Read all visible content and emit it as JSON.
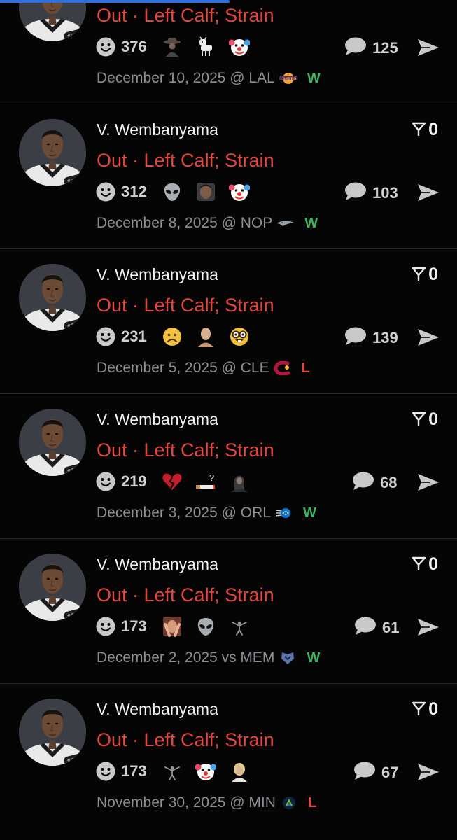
{
  "posts": [
    {
      "name": "",
      "status": "Out · Left Calf; Strain",
      "flag_count": "",
      "react_count": "376",
      "emojis": [
        "cowboy-emoji",
        "goat-emoji",
        "clown-emoji"
      ],
      "comment_count": "125",
      "date": "December 10, 2025 @ LAL",
      "team_logo": "lakers-logo",
      "result": "W",
      "result_color": "#3fb55d"
    },
    {
      "name": "V. Wembanyama",
      "status": "Out · Left Calf; Strain",
      "flag_count": "0",
      "react_count": "312",
      "emojis": [
        "alien-emoji",
        "face-photo-emoji",
        "clown-emoji"
      ],
      "comment_count": "103",
      "date": "December 8, 2025 @ NOP",
      "team_logo": "pelicans-logo",
      "result": "W",
      "result_color": "#3fb55d"
    },
    {
      "name": "V. Wembanyama",
      "status": "Out · Left Calf; Strain",
      "flag_count": "0",
      "react_count": "231",
      "emojis": [
        "frowning-face-emoji",
        "bald-head-emoji",
        "nerd-face-emoji"
      ],
      "comment_count": "139",
      "date": "December 5, 2025 @ CLE",
      "team_logo": "cavaliers-logo",
      "result": "L",
      "result_color": "#e2463c"
    },
    {
      "name": "V. Wembanyama",
      "status": "Out · Left Calf; Strain",
      "flag_count": "0",
      "react_count": "219",
      "emojis": [
        "broken-heart-emoji",
        "cigarette-question-emoji",
        "hooded-figure-emoji"
      ],
      "comment_count": "68",
      "date": "December 3, 2025 @ ORL",
      "team_logo": "magic-logo",
      "result": "W",
      "result_color": "#3fb55d"
    },
    {
      "name": "V. Wembanyama",
      "status": "Out · Left Calf; Strain",
      "flag_count": "0",
      "react_count": "173",
      "emojis": [
        "face-palm-photo-emoji",
        "alien-emoji",
        "dunk-silhouette-emoji"
      ],
      "comment_count": "61",
      "date": "December 2, 2025 vs MEM",
      "team_logo": "grizzlies-logo",
      "result": "W",
      "result_color": "#3fb55d"
    },
    {
      "name": "V. Wembanyama",
      "status": "Out · Left Calf; Strain",
      "flag_count": "0",
      "react_count": "173",
      "emojis": [
        "dunk-silhouette-emoji",
        "clown-emoji",
        "blonde-head-emoji"
      ],
      "comment_count": "67",
      "date": "November 30, 2025 @ MIN",
      "team_logo": "timberwolves-logo",
      "result": "L",
      "result_color": "#e2463c"
    }
  ],
  "colors": {
    "background": "#050506",
    "status_red": "#e2463c",
    "win_green": "#3fb55d",
    "progress_blue": "#2e6fe0"
  }
}
